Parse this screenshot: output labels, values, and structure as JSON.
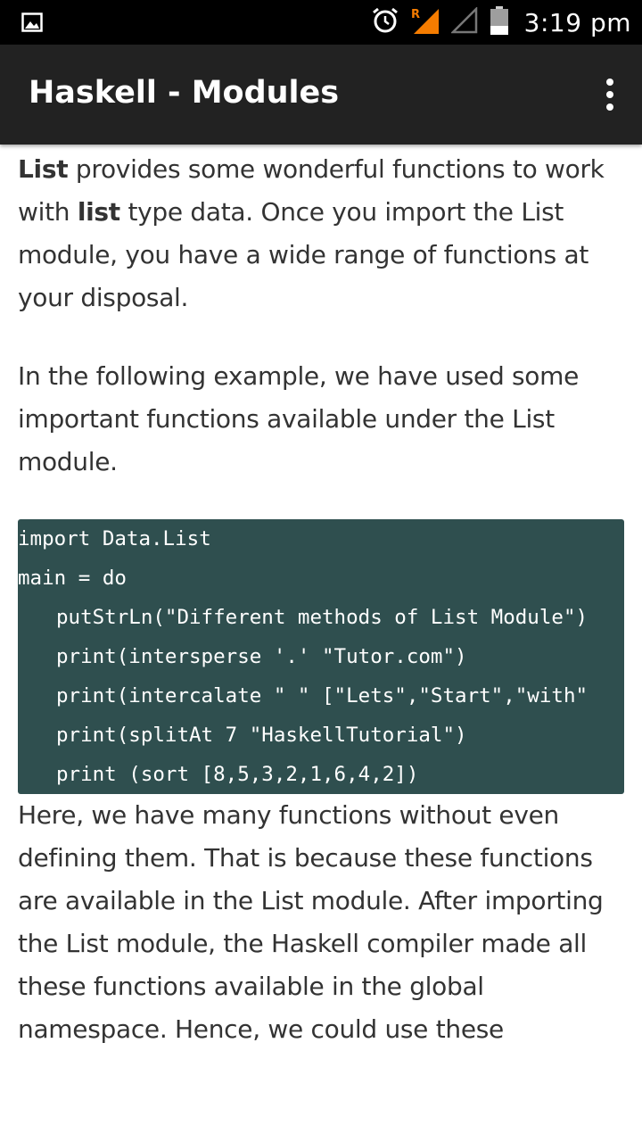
{
  "status_bar": {
    "time": "3:19 pm",
    "icons": [
      "image-icon",
      "alarm-icon",
      "signal-roaming-icon",
      "signal-empty-icon",
      "battery-icon"
    ],
    "roaming_label": "R",
    "roaming_color": "#f57c00"
  },
  "app_bar": {
    "title": "Haskell - Modules",
    "menu_icon": "overflow-menu-icon"
  },
  "content": {
    "p1": {
      "b1": "List",
      "t1": " provides some wonderful functions to work with ",
      "b2": "list",
      "t2": " type data. Once you import the List module, you have a wide range of functions at your disposal."
    },
    "p2": "In the following example, we have used some important functions available under the List module.",
    "code": [
      "import Data.List",
      "main = do",
      "putStrLn(\"Different methods of List Module\")",
      "print(intersperse '.' \"Tutor.com\")",
      "print(intercalate \" \" [\"Lets\",\"Start\",\"with\"",
      "print(splitAt 7 \"HaskellTutorial\")",
      "print (sort [8,5,3,2,1,6,4,2])"
    ],
    "p3": "Here, we have many functions without even defining them. That is because these functions are available in the List module. After importing the List module, the Haskell compiler made all these functions available in the global namespace. Hence, we could use these"
  },
  "colors": {
    "app_bar_bg": "#222222",
    "code_bg": "#2f4f4f",
    "text": "#333333"
  }
}
